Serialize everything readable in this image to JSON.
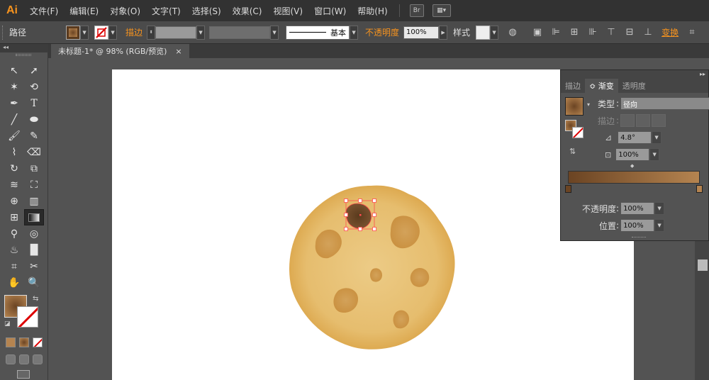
{
  "app": {
    "logo": "Ai"
  },
  "menu": [
    "文件(F)",
    "编辑(E)",
    "对象(O)",
    "文字(T)",
    "选择(S)",
    "效果(C)",
    "视图(V)",
    "窗口(W)",
    "帮助(H)"
  ],
  "menu_buttons": {
    "bridge": "Br",
    "arrange": "▦▾"
  },
  "control": {
    "object_type": "路径",
    "stroke_label": "描边",
    "stroke_profile": "基本",
    "opacity_label": "不透明度",
    "opacity_value": "100%",
    "style_label": "样式",
    "transform_label": "变换"
  },
  "document": {
    "tab_title": "未标题-1* @ 98% (RGB/预览)",
    "close": "×"
  },
  "gradient_panel": {
    "tabs": [
      "描边",
      "≎ 渐变",
      "透明度"
    ],
    "type_label": "类型",
    "type_value": "径向",
    "stroke_label": "描边",
    "angle_value": "4.8°",
    "ratio_value": "100%",
    "stop_opacity_label": "不透明度",
    "stop_opacity_value": "100%",
    "location_label": "位置",
    "location_value": "100%"
  },
  "colors": {
    "gradient_start": "#6b4423",
    "gradient_end": "#b58450",
    "cookie": "#e6bd6e",
    "cookie_edge": "#d9a64a",
    "accent": "#f7931e"
  },
  "tools": [
    "selection-icon",
    "direct-selection-icon",
    "magic-wand-icon",
    "lasso-icon",
    "pen-icon",
    "type-icon",
    "line-icon",
    "ellipse-icon",
    "paintbrush-icon",
    "pencil-icon",
    "blob-brush-icon",
    "eraser-icon",
    "rotate-icon",
    "scale-icon",
    "warp-icon",
    "free-transform-icon",
    "shape-builder-icon",
    "perspective-grid-icon",
    "mesh-icon",
    "gradient-icon",
    "eyedropper-icon",
    "blend-icon",
    "symbol-sprayer-icon",
    "column-graph-icon",
    "artboard-icon",
    "slice-icon",
    "hand-icon",
    "zoom-icon"
  ]
}
